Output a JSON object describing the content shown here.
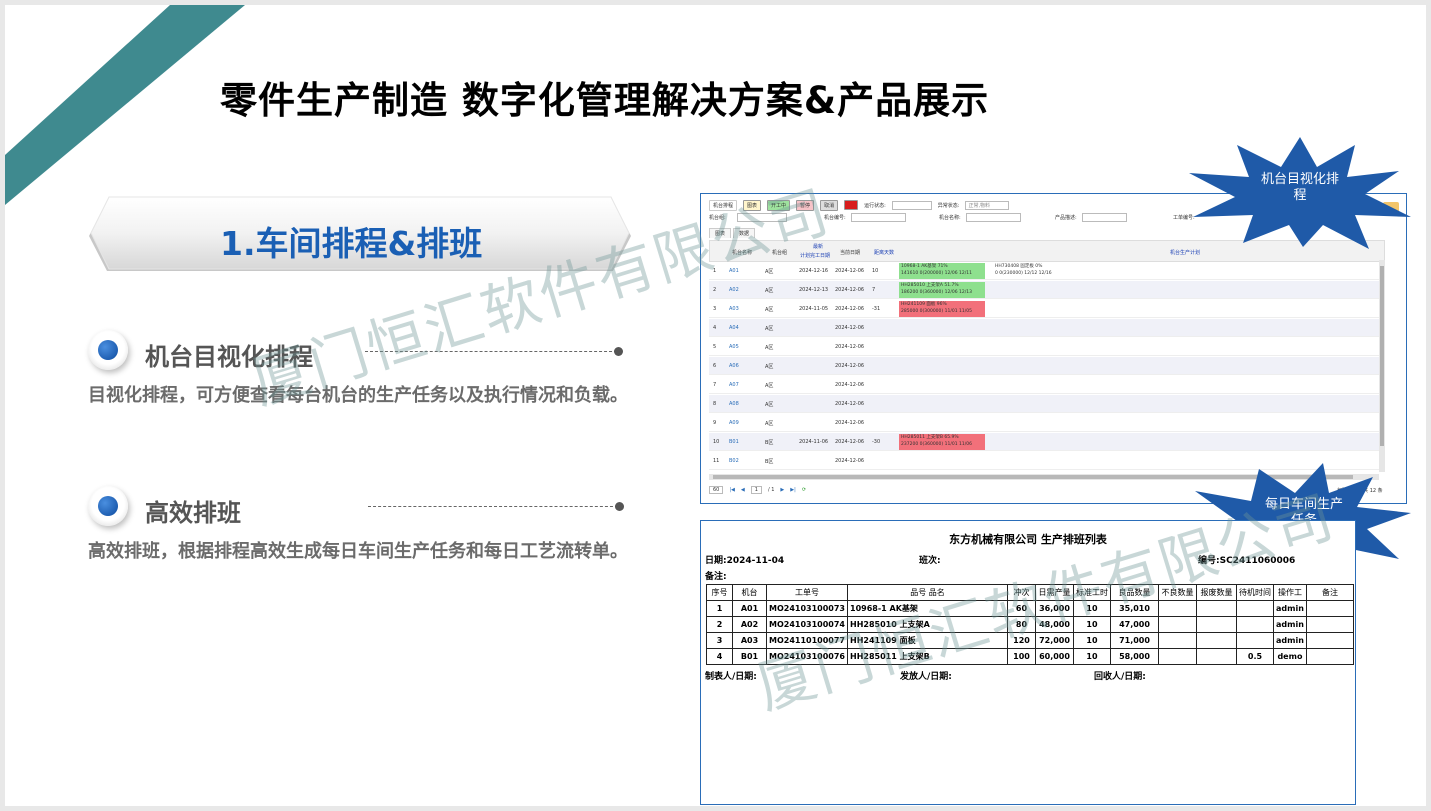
{
  "slide": {
    "title": "零件生产制造 数字化管理解决方案&产品展示",
    "section_title": "1.车间排程&排班",
    "watermark": "厦门恒汇软件有限公司",
    "features": [
      {
        "title": "机台目视化排程",
        "desc": "目视化排程，可方便查看每台机台的生产任务以及执行情况和负载。"
      },
      {
        "title": "高效排班",
        "desc": "高效排班，根据排程高效生成每日车间生产任务和每日工艺流转单。"
      }
    ],
    "callouts": [
      {
        "line1": "机台目视化排",
        "line2": "程"
      },
      {
        "line1": "每日车间生产",
        "line2": "任务"
      }
    ],
    "colors": {
      "accent": "#1a5fb4",
      "corner": "#3f8a8f",
      "star": "#1f5aa8"
    }
  },
  "schedule": {
    "toolbar": {
      "tab_label": "机台排程",
      "buttons": [
        "图表",
        "开工中",
        "暂停",
        "取消"
      ],
      "run_status_label": "运行状态:",
      "abnormal_label": "异常状态:",
      "abnormal_value": "正常,物料"
    },
    "filters": {
      "group": "机台组:",
      "code": "机台编号:",
      "name": "机台名称:",
      "product": "产品描述:",
      "order": "工单编号:"
    },
    "subtabs": [
      "图表",
      "数据"
    ],
    "headers": {
      "name": "机台名称",
      "group": "机台组",
      "latest": "最新",
      "latest2": "计划完工日期",
      "today": "当前日期",
      "days": "距离天数",
      "plan": "机台生产计划"
    },
    "rows": [
      {
        "no": "1",
        "code": "A01",
        "group": "A区",
        "finish": "2024-12-16",
        "today": "2024-12-06",
        "days": "10"
      },
      {
        "no": "2",
        "code": "A02",
        "group": "A区",
        "finish": "2024-12-13",
        "today": "2024-12-06",
        "days": "7"
      },
      {
        "no": "3",
        "code": "A03",
        "group": "A区",
        "finish": "2024-11-05",
        "today": "2024-12-06",
        "days": "-31"
      },
      {
        "no": "4",
        "code": "A04",
        "group": "A区",
        "finish": "",
        "today": "2024-12-06",
        "days": ""
      },
      {
        "no": "5",
        "code": "A05",
        "group": "A区",
        "finish": "",
        "today": "2024-12-06",
        "days": ""
      },
      {
        "no": "6",
        "code": "A06",
        "group": "A区",
        "finish": "",
        "today": "2024-12-06",
        "days": ""
      },
      {
        "no": "7",
        "code": "A07",
        "group": "A区",
        "finish": "",
        "today": "2024-12-06",
        "days": ""
      },
      {
        "no": "8",
        "code": "A08",
        "group": "A区",
        "finish": "",
        "today": "2024-12-06",
        "days": ""
      },
      {
        "no": "9",
        "code": "A09",
        "group": "A区",
        "finish": "",
        "today": "2024-12-06",
        "days": ""
      },
      {
        "no": "10",
        "code": "B01",
        "group": "B区",
        "finish": "2024-11-06",
        "today": "2024-12-06",
        "days": "-30"
      },
      {
        "no": "11",
        "code": "B02",
        "group": "B区",
        "finish": "",
        "today": "2024-12-06",
        "days": ""
      }
    ],
    "tasks": [
      {
        "l1": "10968-1 AK基架  71%",
        "l2": "141610 0(200000) 12/06 12/11"
      },
      {
        "l1": "HH730408 固定板  0%",
        "l2": "0 0(230000) 12/12 12/16"
      },
      {
        "l1": "HH285010 上支架A  51.7%",
        "l2": "186200 0(360000) 12/06 12/13"
      },
      {
        "l1": "HH241109 面板  96%",
        "l2": "285000 0(300000) 11/01 11/05"
      },
      {
        "l1": "HH285011 上支架B  65.9%",
        "l2": "237200 0(360000) 11/01 11/06"
      }
    ],
    "pager": {
      "size": "60",
      "page": "1",
      "total": "/ 1",
      "summary": "每页 60 条 共 12 条"
    }
  },
  "report": {
    "title": "东方机械有限公司 生产排班列表",
    "date": "日期:2024-11-04",
    "shift": "班次:",
    "number": "编号:SC2411060006",
    "note": "备注:",
    "headers": [
      "序号",
      "机台",
      "工单号",
      "品号 品名",
      "冲次",
      "日需产量",
      "标准工时",
      "良品数量",
      "不良数量",
      "报废数量",
      "待机时间",
      "操作工",
      "备注"
    ],
    "rows": [
      [
        "1",
        "A01",
        "MO24103100073",
        "10968-1 AK基架",
        "60",
        "36,000",
        "10",
        "35,010",
        "",
        "",
        "",
        "admin",
        ""
      ],
      [
        "2",
        "A02",
        "MO24103100074",
        "HH285010 上支架A",
        "80",
        "48,000",
        "10",
        "47,000",
        "",
        "",
        "",
        "admin",
        ""
      ],
      [
        "3",
        "A03",
        "MO24110100077",
        "HH241109 面板",
        "120",
        "72,000",
        "10",
        "71,000",
        "",
        "",
        "",
        "admin",
        ""
      ],
      [
        "4",
        "B01",
        "MO24103100076",
        "HH285011 上支架B",
        "100",
        "60,000",
        "10",
        "58,000",
        "",
        "",
        "0.5",
        "demo",
        ""
      ]
    ],
    "footer": {
      "maker": "制表人/日期:",
      "issuer": "发放人/日期:",
      "receiver": "回收人/日期:"
    }
  }
}
